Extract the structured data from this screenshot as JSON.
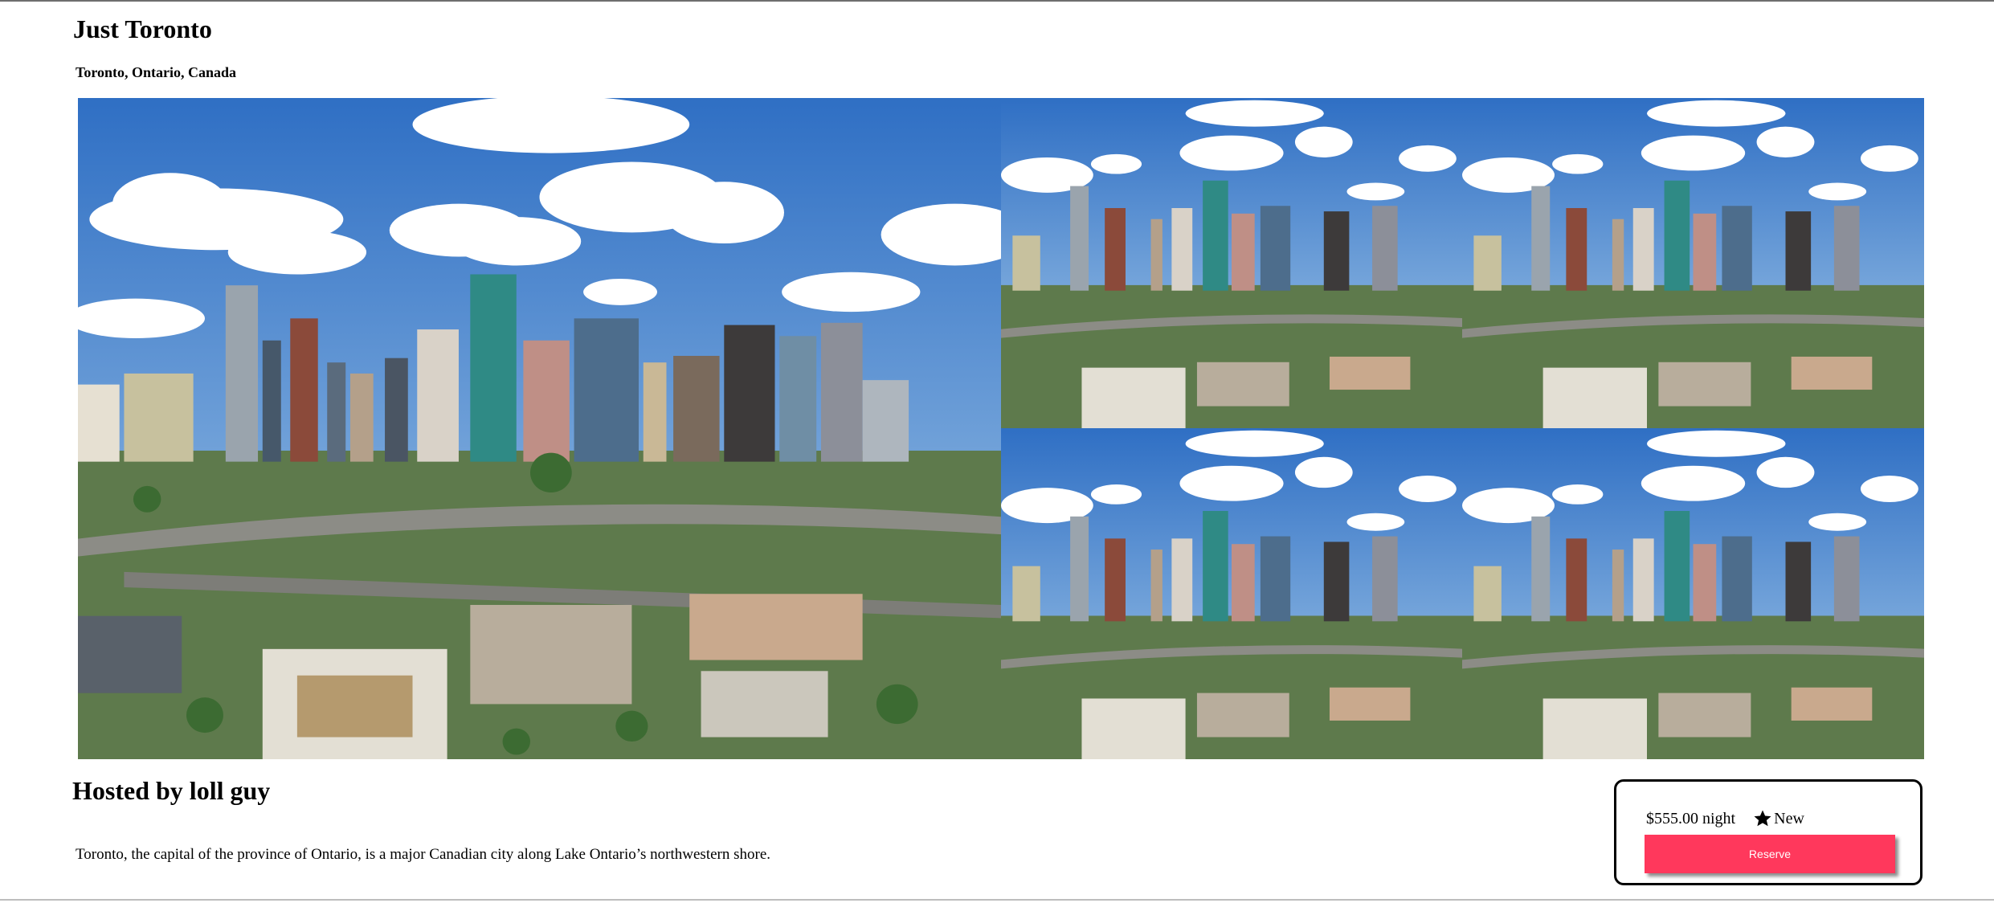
{
  "listing": {
    "title": "Just Toronto",
    "location": "Toronto, Ontario, Canada"
  },
  "gallery": {
    "photos": [
      {
        "name": "city skyline aerial view",
        "role": "main"
      },
      {
        "name": "city skyline aerial view",
        "role": "thumbnail"
      },
      {
        "name": "city skyline aerial view",
        "role": "thumbnail"
      },
      {
        "name": "city skyline aerial view",
        "role": "thumbnail"
      },
      {
        "name": "city skyline aerial view",
        "role": "thumbnail"
      }
    ]
  },
  "host": {
    "heading": "Hosted by loll guy",
    "description": "Toronto, the capital of the province of Ontario, is a major Canadian city along Lake Ontario’s northwestern shore."
  },
  "booking": {
    "price": "$555.00 night",
    "rating_icon": "star-icon",
    "rating_label": "New",
    "reserve_label": "Reserve",
    "accent_color": "#ff385c"
  }
}
